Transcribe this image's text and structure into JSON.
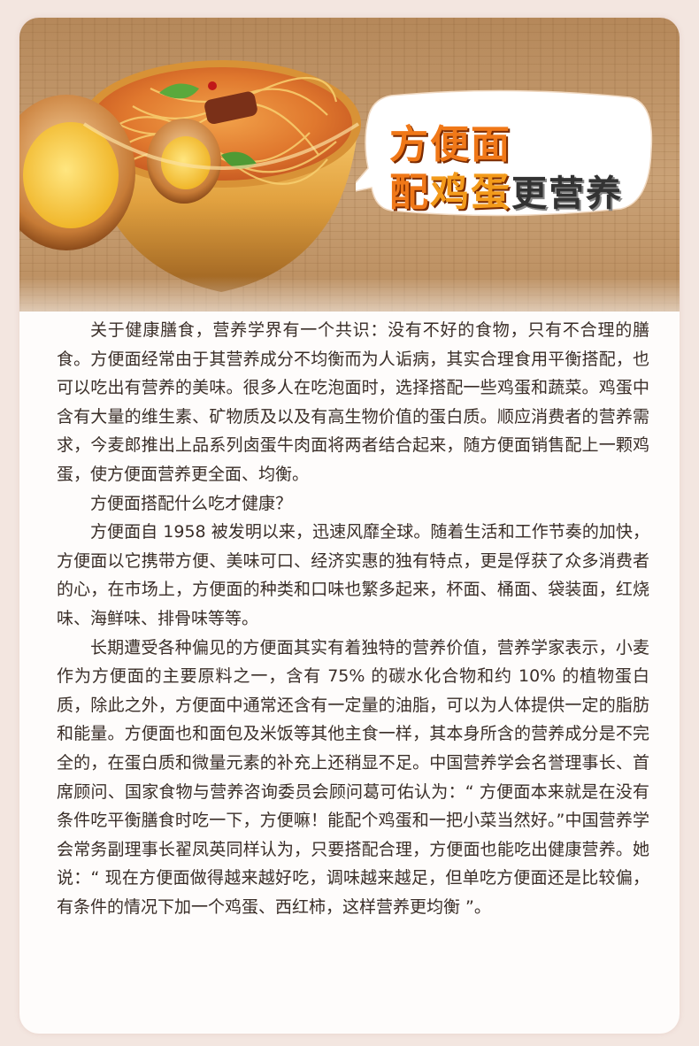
{
  "banner": {
    "title_line1": "方便面",
    "title_line2_a": "配",
    "title_line2_b": "鸡蛋",
    "title_line2_c": "更营养"
  },
  "article": {
    "paragraphs": [
      "关于健康膳食，营养学界有一个共识：没有不好的食物，只有不合理的膳食。方便面经常由于其营养成分不均衡而为人诟病，其实合理食用平衡搭配，也可以吃出有营养的美味。很多人在吃泡面时，选择搭配一些鸡蛋和蔬菜。鸡蛋中含有大量的维生素、矿物质及以及有高生物价值的蛋白质。顺应消费者的营养需求，今麦郎推出上品系列卤蛋牛肉面将两者结合起来，随方便面销售配上一颗鸡蛋，使方便面营养更全面、均衡。",
      "方便面搭配什么吃才健康？",
      "方便面自 1958 被发明以来，迅速风靡全球。随着生活和工作节奏的加快，方便面以它携带方便、美味可口、经济实惠的独有特点，更是俘获了众多消费者的心，在市场上，方便面的种类和口味也繁多起来，杯面、桶面、袋装面，红烧味、海鲜味、排骨味等等。",
      "长期遭受各种偏见的方便面其实有着独特的营养价值，营养学家表示，小麦作为方便面的主要原料之一，含有 75% 的碳水化合物和约 10% 的植物蛋白质，除此之外，方便面中通常还含有一定量的油脂，可以为人体提供一定的脂肪和能量。方便面也和面包及米饭等其他主食一样，其本身所含的营养成分是不完全的，在蛋白质和微量元素的补充上还稍显不足。中国营养学会名誉理事长、首席顾问、国家食物与营养咨询委员会顾问葛可佑认为：“ 方便面本来就是在没有条件吃平衡膳食时吃一下，方便嘛！能配个鸡蛋和一把小菜当然好。”中国营养学会常务副理事长翟凤英同样认为，只要搭配合理，方便面也能吃出健康营养。她说：“ 现在方便面做得越来越好吃，调味越来越足，但单吃方便面还是比较偏，有条件的情况下加一个鸡蛋、西红柿，这样营养更均衡 ”。"
    ]
  },
  "colors": {
    "title_orange": "#f07818",
    "body_text": "#3a2e28",
    "card_bg": "#fefcfb",
    "page_bg": "#f3e6e0"
  },
  "icons": [
    "noodle-bowl-illustration",
    "braised-egg-illustration",
    "chopsticks-illustration",
    "speech-bubble"
  ]
}
